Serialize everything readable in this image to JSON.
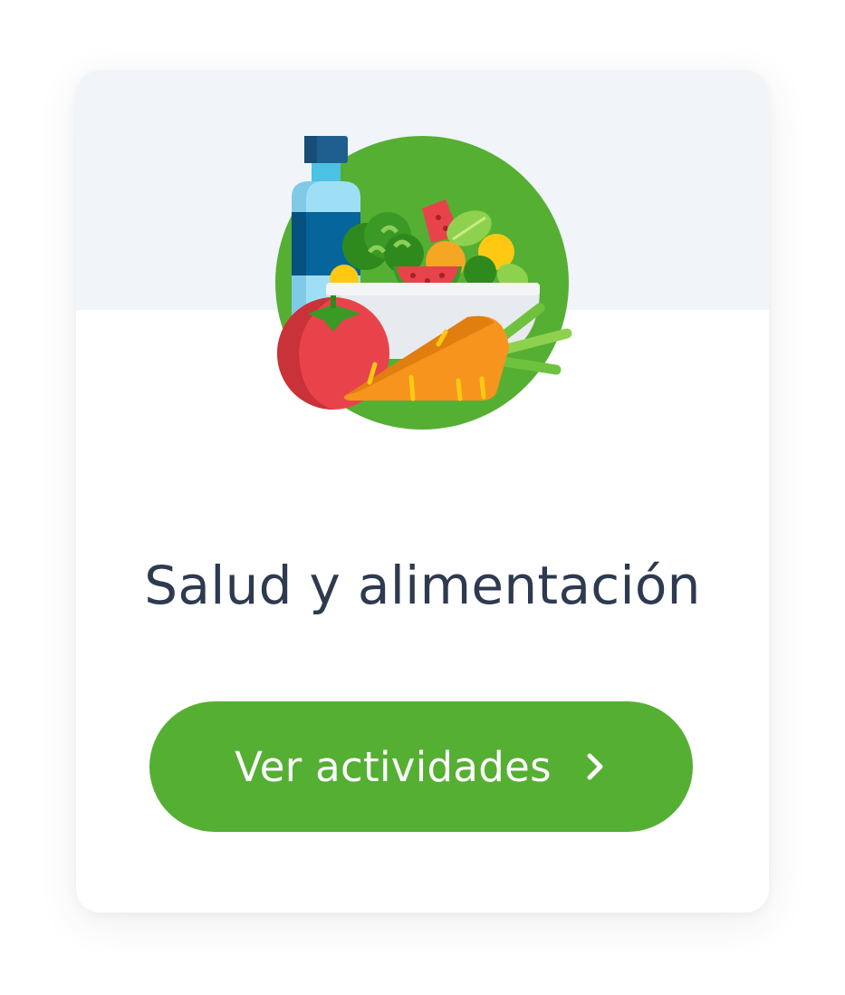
{
  "card": {
    "title": "Salud y alimentación",
    "illustration_icon": "healthy-food-icon",
    "button_label": "Ver actividades",
    "button_icon": "chevron-right-icon"
  },
  "colors": {
    "page_background": "#ffffff",
    "card_background": "#ffffff",
    "header_band": "#f1f4f8",
    "title_text": "#2d3a4f",
    "button_background": "#55af33",
    "button_text": "#ffffff",
    "illustration_circle": "#55af33"
  }
}
